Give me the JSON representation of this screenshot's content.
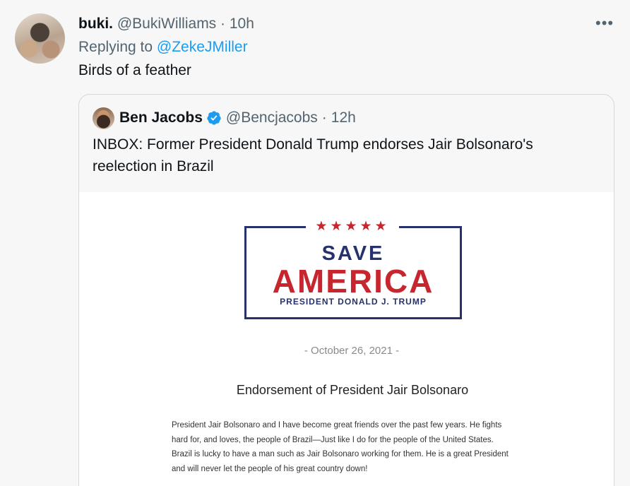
{
  "tweet": {
    "display_name": "buki.",
    "handle": "@BukiWilliams",
    "separator": "·",
    "time": "10h",
    "more_label": "•••",
    "reply_prefix": "Replying to",
    "reply_mention": "@ZekeJMiller",
    "text": "Birds of a feather"
  },
  "quote": {
    "display_name": "Ben Jacobs",
    "handle": "@Bencjacobs",
    "separator": "·",
    "time": "12h",
    "text": "INBOX: Former President Donald Trump endorses Jair Bolsonaro's reelection in Brazil",
    "image": {
      "stars": "★★★★★",
      "logo_line1": "SAVE",
      "logo_line2": "AMERICA",
      "logo_sub": "PRESIDENT DONALD J. TRUMP",
      "date": "- October 26, 2021 -",
      "title": "Endorsement of President Jair Bolsonaro",
      "body_lines": [
        "President Jair Bolsonaro and I have become great friends over the past few years. He fights",
        "hard for, and loves, the people of Brazil—Just like I do for the people of the United States.",
        "Brazil is lucky to have a man such as Jair Bolsonaro working for them. He is a great President",
        "and will never let the people of his great country down!"
      ]
    }
  },
  "colors": {
    "link": "#1d9bf0",
    "secondary_text": "#536471",
    "logo_navy": "#27316b",
    "logo_red": "#c8262f",
    "verified_badge": "#1d9bf0"
  },
  "icons": {
    "verified": "verified-badge-icon",
    "more": "more-horizontal-icon"
  }
}
